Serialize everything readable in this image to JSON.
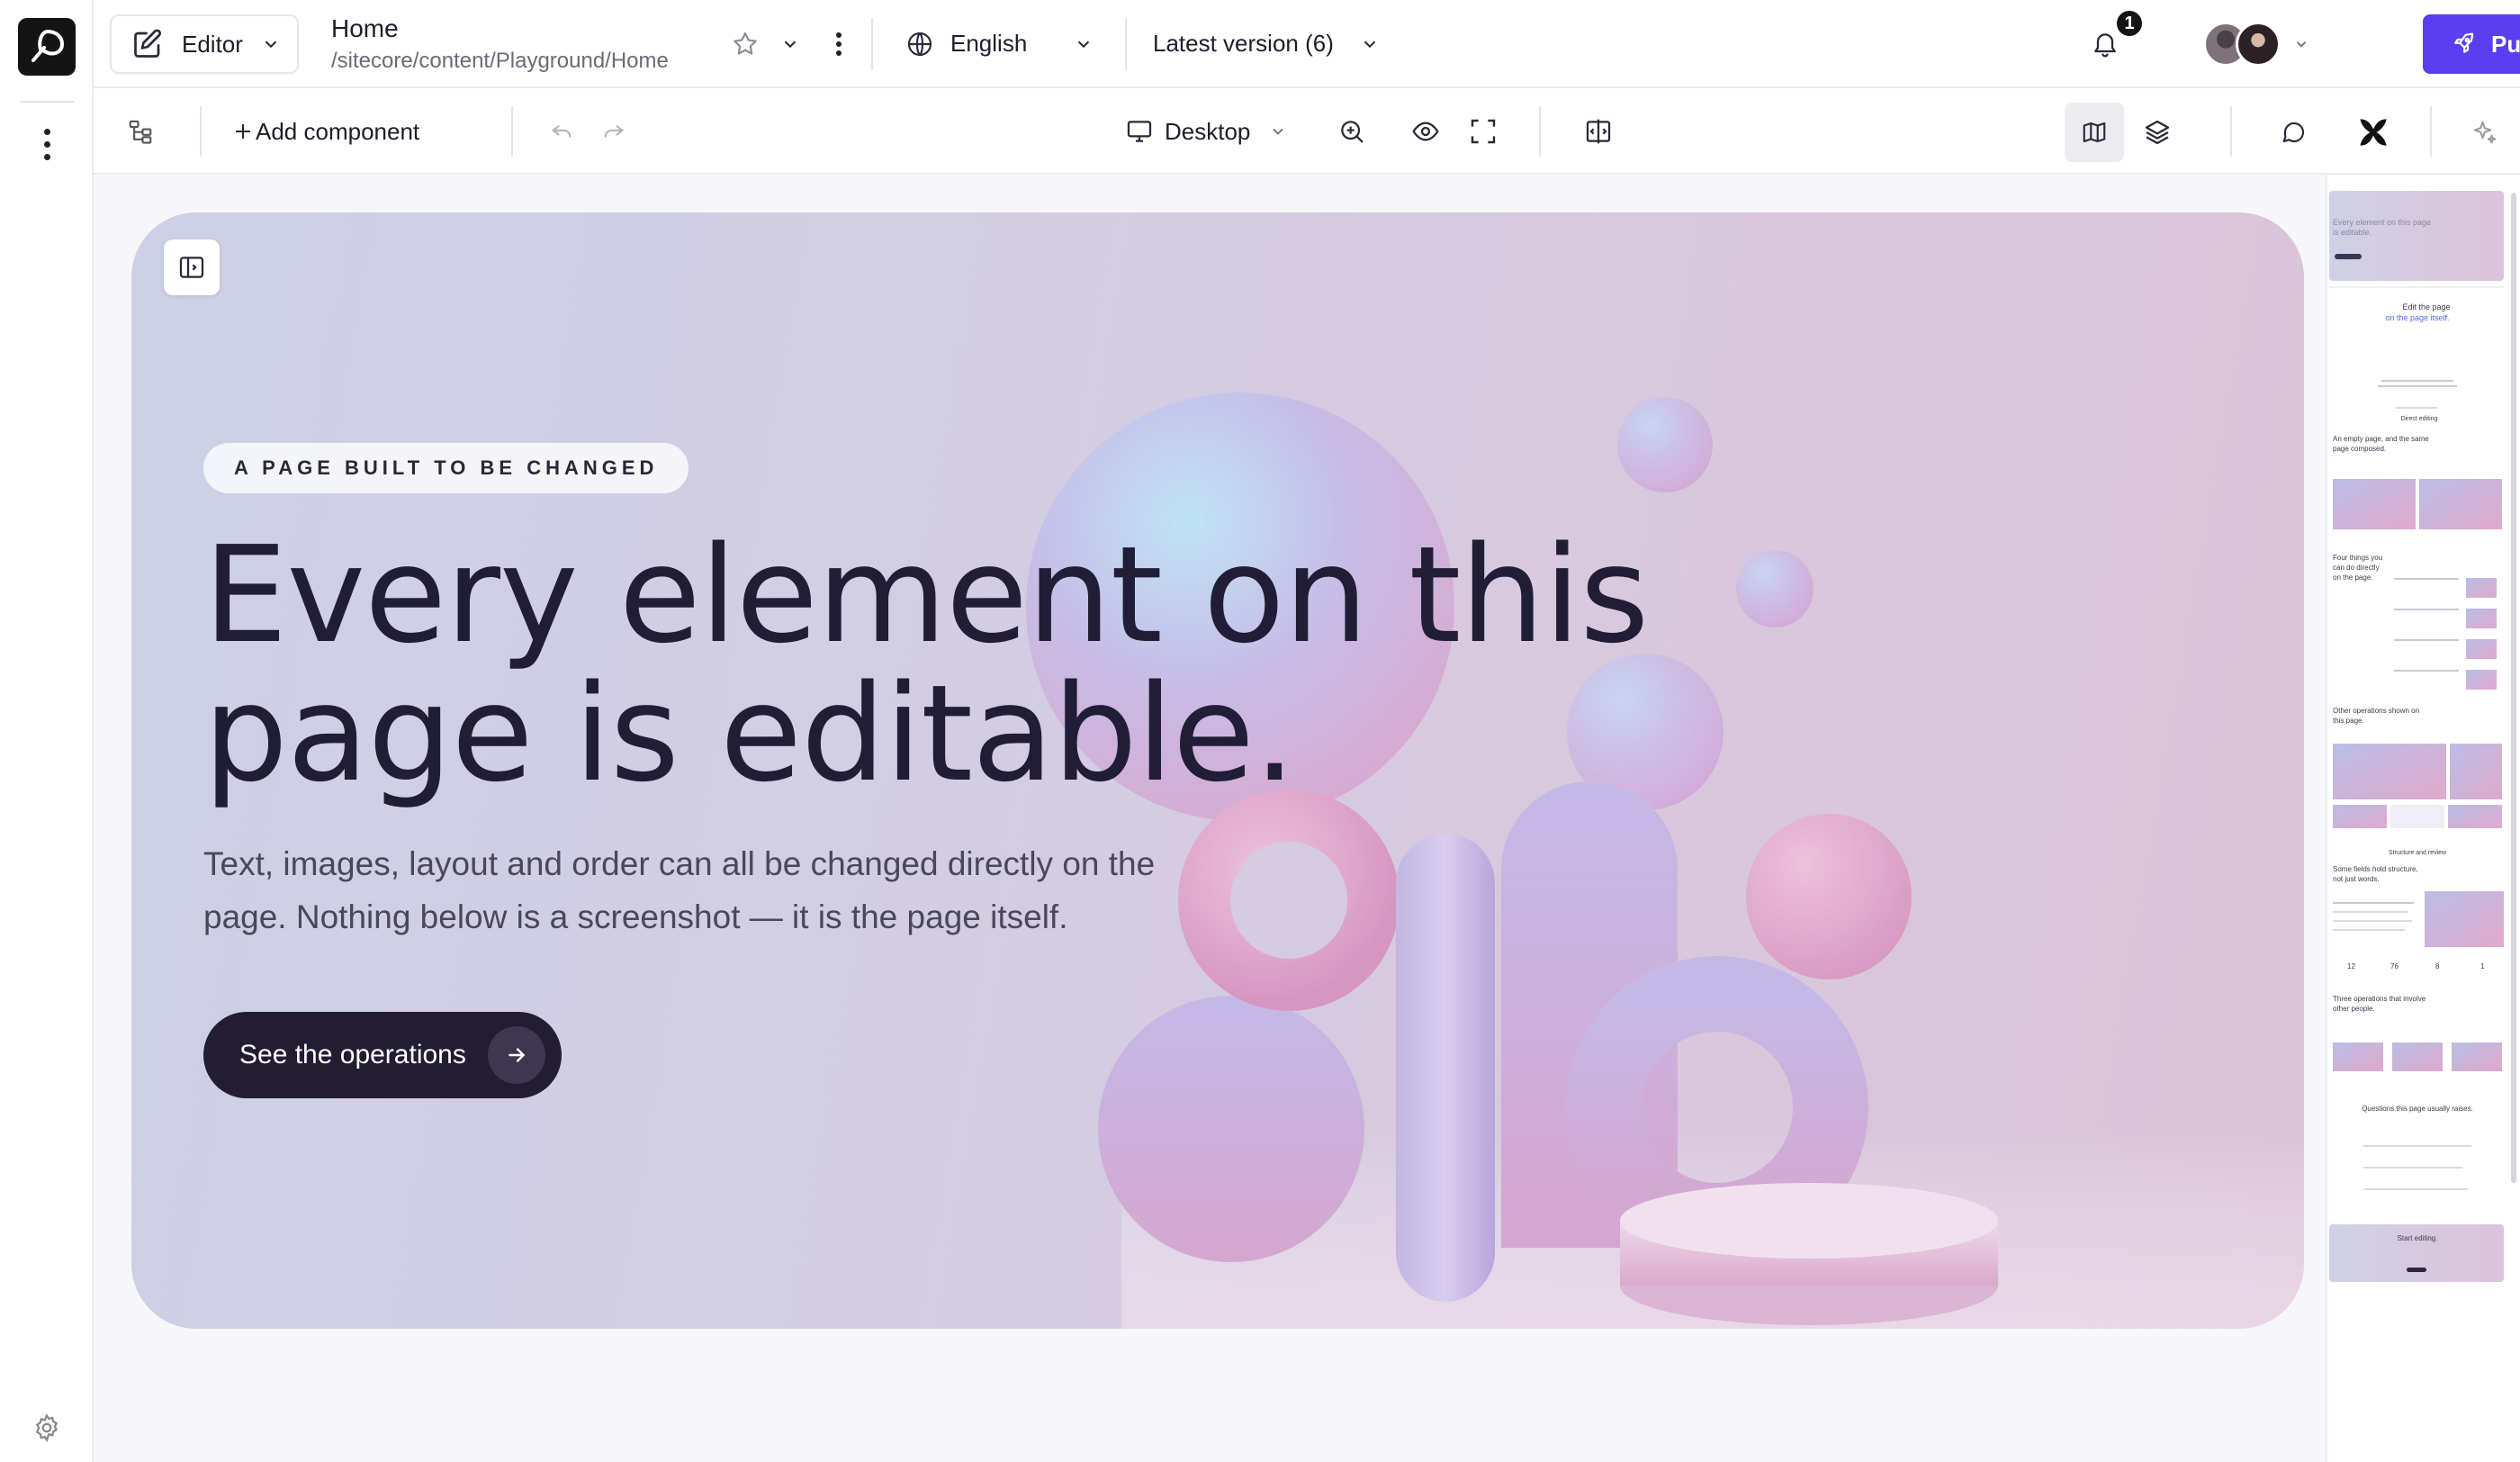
{
  "header": {
    "mode_label": "Editor",
    "page_title": "Home",
    "page_path": "/sitecore/content/Playground/Home",
    "language": "English",
    "version": "Latest version (6)",
    "notification_count": "1",
    "publish_label": "Publish"
  },
  "toolbar": {
    "add_component_label": "Add component",
    "device_label": "Desktop"
  },
  "hero": {
    "eyebrow": "A PAGE BUILT TO BE CHANGED",
    "headline_line1": "Every element on this",
    "headline_line2": "page is editable.",
    "subtext_line1": "Text, images, layout and order can all be changed directly on the",
    "subtext_line2": "page. Nothing below is a screenshot — it is the page itself.",
    "cta_label": "See the operations"
  },
  "minimap": {
    "hero_text": "Every element on this page is editable.",
    "section1_title": "Edit the page",
    "section1_accent": "on the page itself.",
    "section2_label": "Direct editing",
    "section3_title": "An empty page, and the same page composed.",
    "section4_title": "Four things you can do directly on the page.",
    "section5_title": "Other operations shown on this page.",
    "section6_label": "Structure and review",
    "section7_title": "Some fields hold structure, not just words.",
    "stats": [
      "12",
      "76",
      "8",
      "1"
    ],
    "section8_title": "Three operations that involve other people.",
    "section9_title": "Questions this page usually raises.",
    "section10_title": "Start editing."
  },
  "colors": {
    "publish": "#5b3ef0",
    "cta_bg": "#221d33",
    "headline": "#211d36"
  }
}
